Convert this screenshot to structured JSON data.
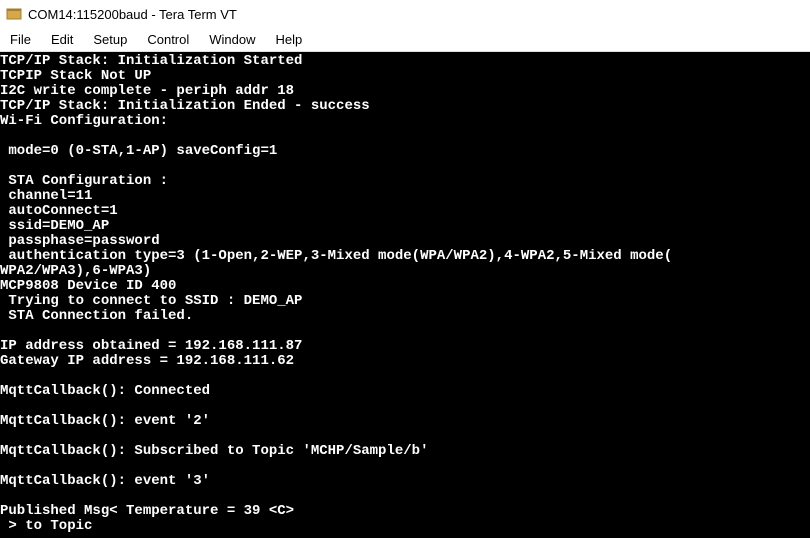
{
  "titlebar": {
    "text": "COM14:115200baud - Tera Term VT"
  },
  "menubar": {
    "file": "File",
    "edit": "Edit",
    "setup": "Setup",
    "control": "Control",
    "window": "Window",
    "help": "Help"
  },
  "terminal": {
    "lines": [
      "TCP/IP Stack: Initialization Started",
      "TCPIP Stack Not UP",
      "I2C write complete - periph addr 18",
      "TCP/IP Stack: Initialization Ended - success",
      "Wi-Fi Configuration:",
      "",
      " mode=0 (0-STA,1-AP) saveConfig=1",
      "",
      " STA Configuration :",
      " channel=11",
      " autoConnect=1",
      " ssid=DEMO_AP",
      " passphase=password",
      " authentication type=3 (1-Open,2-WEP,3-Mixed mode(WPA/WPA2),4-WPA2,5-Mixed mode(",
      "WPA2/WPA3),6-WPA3)",
      "MCP9808 Device ID 400",
      " Trying to connect to SSID : DEMO_AP",
      " STA Connection failed.",
      "",
      "IP address obtained = 192.168.111.87",
      "Gateway IP address = 192.168.111.62",
      "",
      "MqttCallback(): Connected",
      "",
      "MqttCallback(): event '2'",
      "",
      "MqttCallback(): Subscribed to Topic 'MCHP/Sample/b'",
      "",
      "MqttCallback(): event '3'",
      "",
      "Published Msg< Temperature = 39 <C>",
      " > to Topic"
    ]
  }
}
